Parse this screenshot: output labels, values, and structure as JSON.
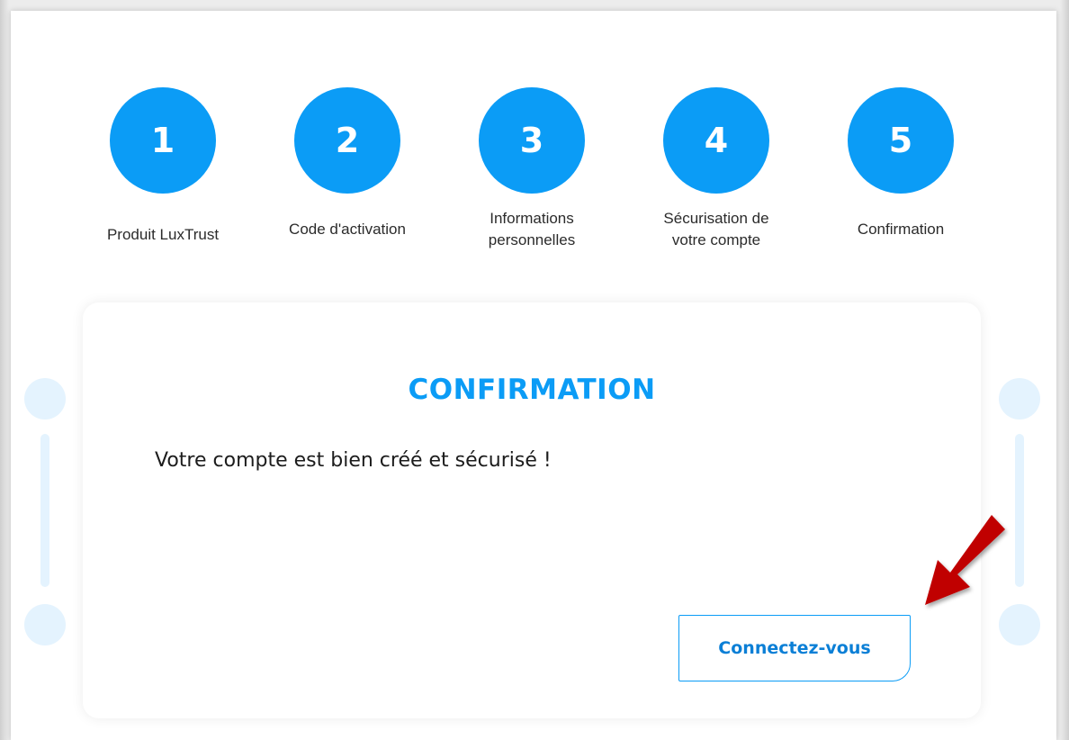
{
  "steps": [
    {
      "number": "1",
      "label": "Produit LuxTrust"
    },
    {
      "number": "2",
      "label": "Code d'activation"
    },
    {
      "number": "3",
      "label": "Informations personnelles"
    },
    {
      "number": "4",
      "label": "Sécurisation de votre compte"
    },
    {
      "number": "5",
      "label": "Confirmation"
    }
  ],
  "card": {
    "title": "CONFIRMATION",
    "message": "Votre compte est bien créé et sécurisé !",
    "button_label": "Connectez-vous"
  },
  "colors": {
    "accent": "#0b9cf6",
    "annotation_arrow": "#c00000",
    "decoration": "#e4f3fe"
  },
  "icons": [
    "arrow-annotation-icon"
  ]
}
